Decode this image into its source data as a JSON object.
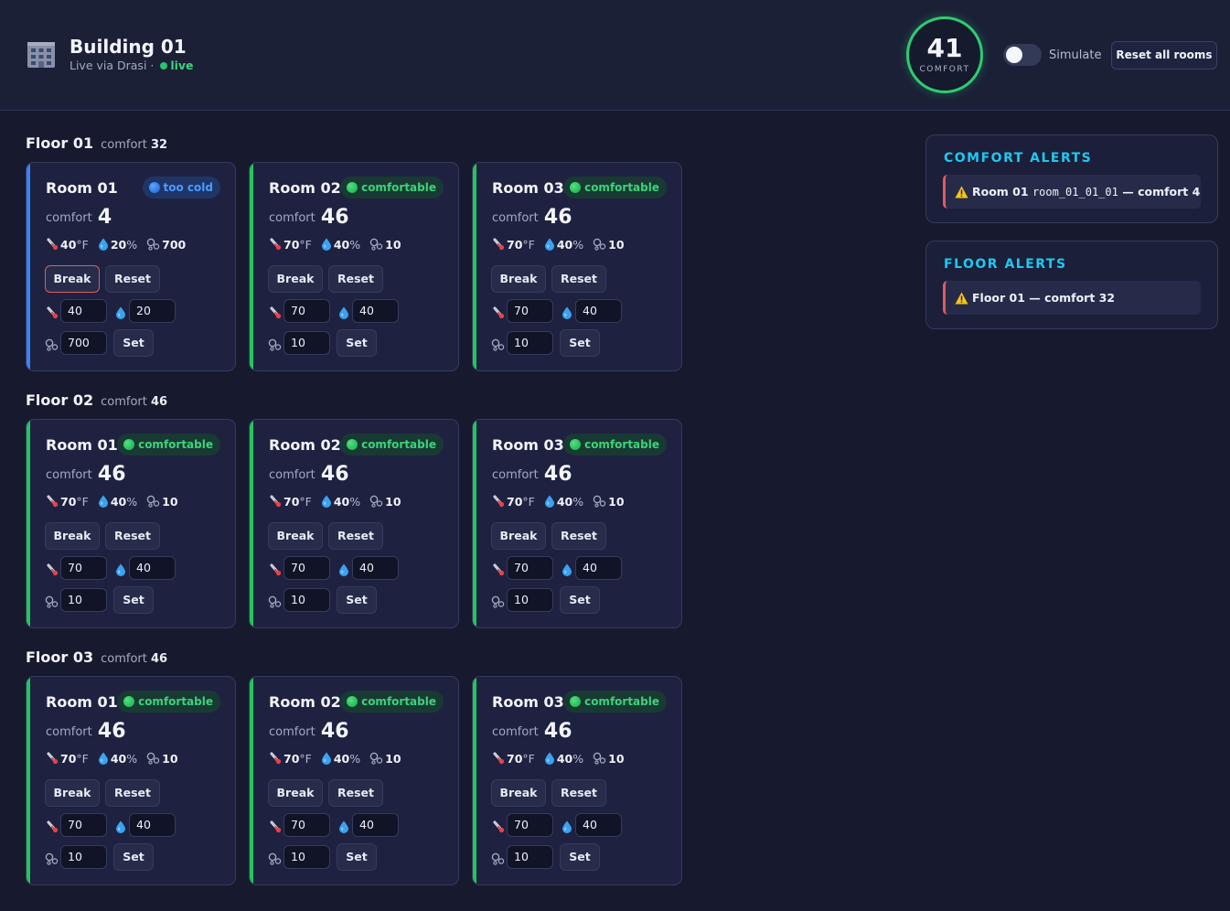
{
  "header": {
    "title": "Building 01",
    "subtitle": "Live via Drasi ·",
    "live_label": "live",
    "comfort_value": "41",
    "comfort_label": "COMFORT",
    "simulate_label": "Simulate",
    "simulate_on": false,
    "reset_all_label": "Reset all rooms"
  },
  "labels": {
    "comfort": "comfort",
    "temp_unit": "°F",
    "humidity_unit": "%",
    "break": "Break",
    "reset": "Reset",
    "set": "Set"
  },
  "status_colors": {
    "comfortable": "#22c55e",
    "too_cold": "#3b82f6",
    "alert": "#e15a63",
    "accent": "#1ec9f0"
  },
  "icons": [
    "building-icon",
    "thermometer-icon",
    "droplet-icon",
    "co2-icon",
    "warning-icon"
  ],
  "floors": [
    {
      "name": "Floor 01",
      "comfort_label": "comfort",
      "comfort": "32",
      "rooms": [
        {
          "name": "Room 01",
          "status": "too cold",
          "status_key": "too_cold",
          "comfort": "4",
          "temp": "40",
          "humidity": "20",
          "co2": "700",
          "temp_input": "40",
          "humidity_input": "20",
          "co2_input": "700",
          "break_highlight": true
        },
        {
          "name": "Room 02",
          "status": "comfortable",
          "status_key": "comfortable",
          "comfort": "46",
          "temp": "70",
          "humidity": "40",
          "co2": "10",
          "temp_input": "70",
          "humidity_input": "40",
          "co2_input": "10",
          "break_highlight": false
        },
        {
          "name": "Room 03",
          "status": "comfortable",
          "status_key": "comfortable",
          "comfort": "46",
          "temp": "70",
          "humidity": "40",
          "co2": "10",
          "temp_input": "70",
          "humidity_input": "40",
          "co2_input": "10",
          "break_highlight": false
        }
      ]
    },
    {
      "name": "Floor 02",
      "comfort_label": "comfort",
      "comfort": "46",
      "rooms": [
        {
          "name": "Room 01",
          "status": "comfortable",
          "status_key": "comfortable",
          "comfort": "46",
          "temp": "70",
          "humidity": "40",
          "co2": "10",
          "temp_input": "70",
          "humidity_input": "40",
          "co2_input": "10",
          "break_highlight": false
        },
        {
          "name": "Room 02",
          "status": "comfortable",
          "status_key": "comfortable",
          "comfort": "46",
          "temp": "70",
          "humidity": "40",
          "co2": "10",
          "temp_input": "70",
          "humidity_input": "40",
          "co2_input": "10",
          "break_highlight": false
        },
        {
          "name": "Room 03",
          "status": "comfortable",
          "status_key": "comfortable",
          "comfort": "46",
          "temp": "70",
          "humidity": "40",
          "co2": "10",
          "temp_input": "70",
          "humidity_input": "40",
          "co2_input": "10",
          "break_highlight": false
        }
      ]
    },
    {
      "name": "Floor 03",
      "comfort_label": "comfort",
      "comfort": "46",
      "rooms": [
        {
          "name": "Room 01",
          "status": "comfortable",
          "status_key": "comfortable",
          "comfort": "46",
          "temp": "70",
          "humidity": "40",
          "co2": "10",
          "temp_input": "70",
          "humidity_input": "40",
          "co2_input": "10",
          "break_highlight": false
        },
        {
          "name": "Room 02",
          "status": "comfortable",
          "status_key": "comfortable",
          "comfort": "46",
          "temp": "70",
          "humidity": "40",
          "co2": "10",
          "temp_input": "70",
          "humidity_input": "40",
          "co2_input": "10",
          "break_highlight": false
        },
        {
          "name": "Room 03",
          "status": "comfortable",
          "status_key": "comfortable",
          "comfort": "46",
          "temp": "70",
          "humidity": "40",
          "co2": "10",
          "temp_input": "70",
          "humidity_input": "40",
          "co2_input": "10",
          "break_highlight": false
        }
      ]
    }
  ],
  "comfort_alerts": {
    "title": "COMFORT ALERTS",
    "items": [
      {
        "room": "Room 01",
        "id": "room_01_01_01",
        "text": "— comfort 4"
      }
    ]
  },
  "floor_alerts": {
    "title": "FLOOR ALERTS",
    "items": [
      {
        "text": "Floor 01 — comfort 32"
      }
    ]
  }
}
